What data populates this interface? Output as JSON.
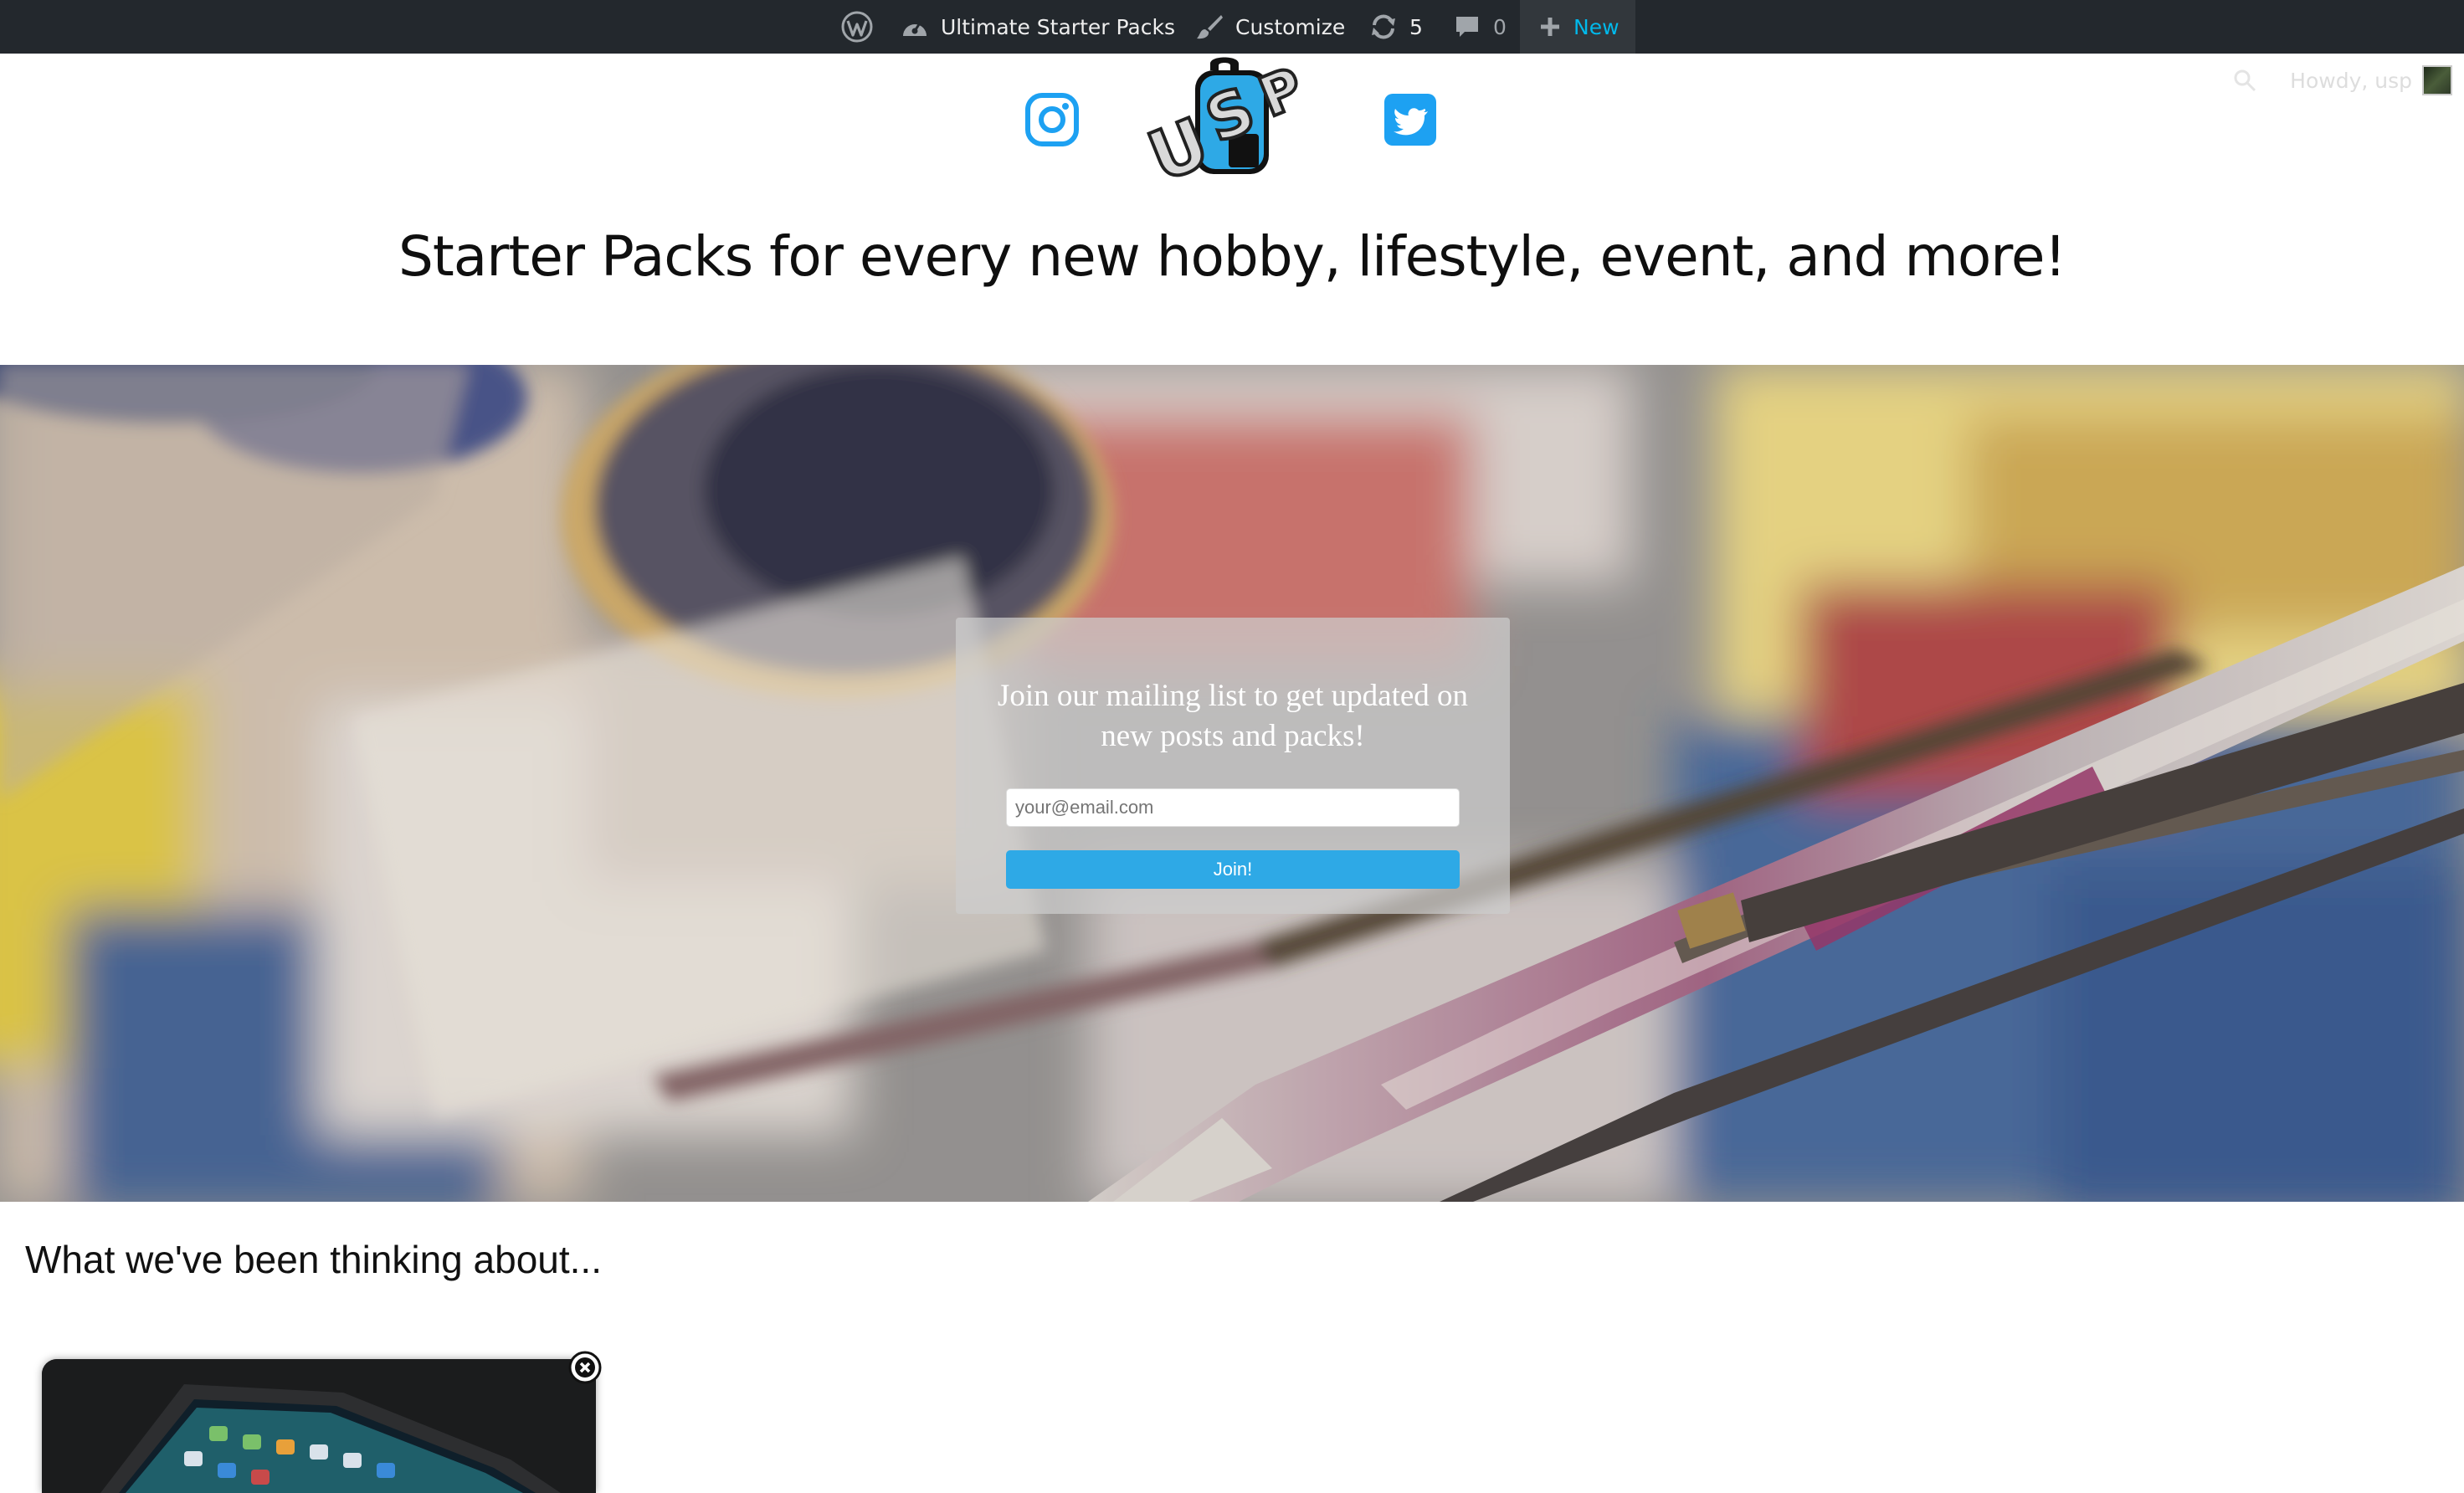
{
  "adminbar": {
    "site_name": "Ultimate Starter Packs",
    "customize_label": "Customize",
    "updates_count": "5",
    "comments_count": "0",
    "new_label": "New",
    "howdy_text": "Howdy, usp"
  },
  "header": {
    "logo_alt": "USP",
    "tagline": "Starter Packs for every new hobby, lifestyle, event, and more!"
  },
  "signup": {
    "title": "Join our mailing list to get updated on new posts and packs!",
    "email_placeholder": "your@email.com",
    "button_label": "Join!"
  },
  "content": {
    "section_heading": "What we've been thinking about..."
  },
  "colors": {
    "adminbar_bg": "#23282d",
    "accent_blue": "#00b9eb",
    "social_blue": "#1da1f2",
    "join_button": "#2ea9e6"
  },
  "icons": {
    "wordpress": "wordpress-logo-icon",
    "site": "dashboard-icon",
    "customize": "paintbrush-icon",
    "updates": "updates-icon",
    "comments": "comment-icon",
    "new": "plus-icon",
    "search": "search-icon",
    "instagram": "instagram-icon",
    "twitter": "twitter-icon",
    "close": "close-icon"
  }
}
